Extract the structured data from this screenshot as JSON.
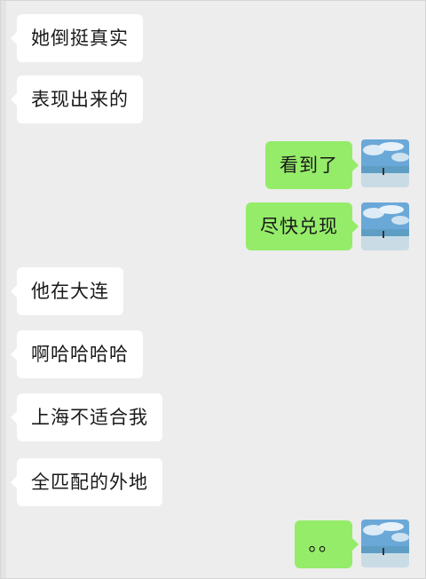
{
  "messages": [
    {
      "side": "in",
      "text": "她倒挺真实"
    },
    {
      "side": "in",
      "text": "表现出来的"
    },
    {
      "side": "out",
      "text": "看到了"
    },
    {
      "side": "out",
      "text": "尽快兑现"
    },
    {
      "side": "in",
      "text": "他在大连"
    },
    {
      "side": "in",
      "text": "啊哈哈哈哈"
    },
    {
      "side": "in",
      "text": "上海不适合我"
    },
    {
      "side": "in",
      "text": "全匹配的外地"
    },
    {
      "side": "out",
      "text": "。。"
    }
  ],
  "colors": {
    "background": "#ededed",
    "incoming_bubble": "#ffffff",
    "outgoing_bubble": "#95ec69"
  },
  "icons": {
    "self_avatar": "beach-sky-avatar-icon"
  }
}
